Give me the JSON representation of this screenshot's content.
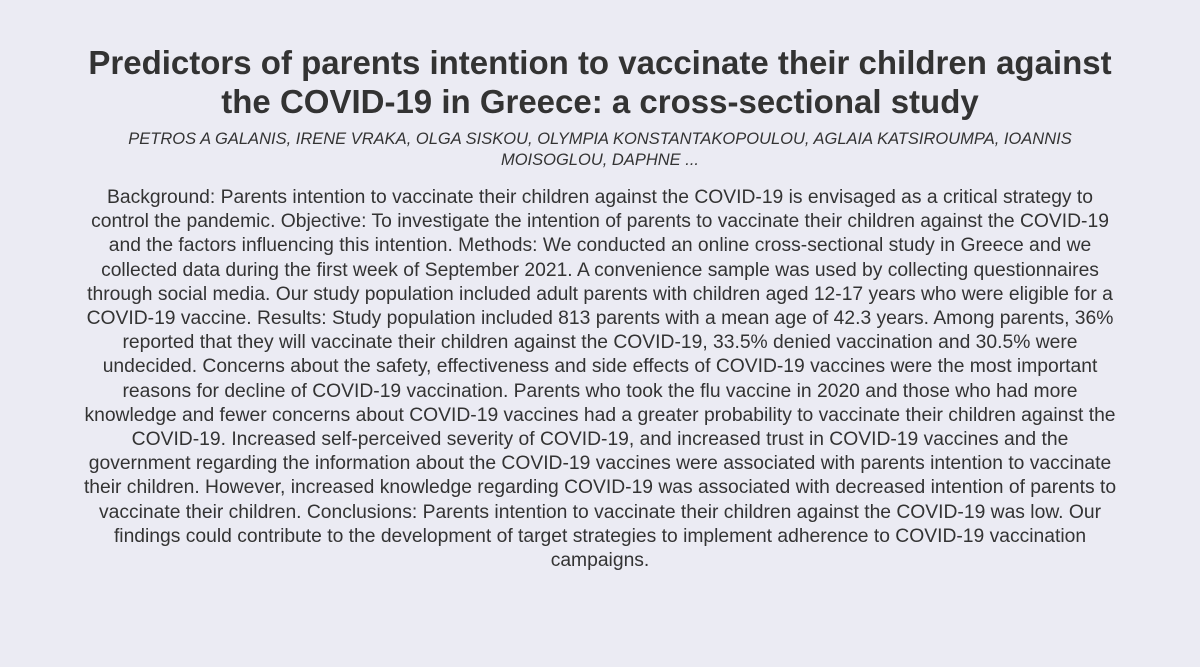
{
  "paper": {
    "title": "Predictors of parents intention to vaccinate their children against the COVID-19 in Greece: a cross-sectional study",
    "authors": "PETROS A GALANIS, IRENE VRAKA, OLGA SISKOU, OLYMPIA KONSTANTAKOPOULOU, AGLAIA KATSIROUMPA, IOANNIS MOISOGLOU, DAPHNE ...",
    "abstract": "Background: Parents intention to vaccinate their children against the COVID-19 is envisaged as a critical strategy to control the pandemic. Objective: To investigate the intention of parents to vaccinate their children against the COVID-19 and the factors influencing this intention. Methods: We conducted an online cross-sectional study in Greece and we collected data during the first week of September 2021. A convenience sample was used by collecting questionnaires through social media. Our study population included adult parents with children aged 12-17 years who were eligible for a COVID-19 vaccine. Results: Study population included 813 parents with a mean age of 42.3 years. Among parents, 36% reported that they will vaccinate their children against the COVID-19, 33.5% denied vaccination and 30.5% were undecided. Concerns about the safety, effectiveness and side effects of COVID-19 vaccines were the most important reasons for decline of COVID-19 vaccination. Parents who took the flu vaccine in 2020 and those who had more knowledge and fewer concerns about COVID-19 vaccines had a greater probability to vaccinate their children against the COVID-19. Increased self-perceived severity of COVID-19, and increased trust in COVID-19 vaccines and the government regarding the information about the COVID-19 vaccines were associated with parents intention to vaccinate their children. However, increased knowledge regarding COVID-19 was associated with decreased intention of parents to vaccinate their children. Conclusions: Parents intention to vaccinate their children against the COVID-19 was low. Our findings could contribute to the development of target strategies to implement adherence to COVID-19 vaccination campaigns."
  }
}
